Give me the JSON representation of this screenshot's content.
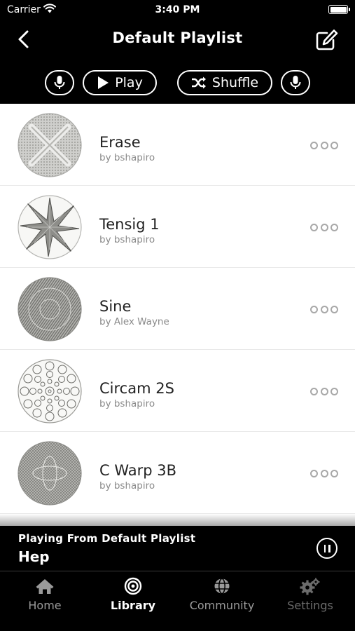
{
  "status_bar": {
    "carrier": "Carrier",
    "time": "3:40 PM"
  },
  "header": {
    "title": "Default Playlist",
    "back_icon": "chevron-left-icon",
    "edit_icon": "edit-square-icon"
  },
  "controls": {
    "play_label": "Play",
    "shuffle_label": "Shuffle"
  },
  "tracks": [
    {
      "title": "Erase",
      "author": "by bshapiro",
      "pattern": "x-cross"
    },
    {
      "title": "Tensig 1",
      "author": "by bshapiro",
      "pattern": "star"
    },
    {
      "title": "Sine",
      "author": "by Alex Wayne",
      "pattern": "dense-texture"
    },
    {
      "title": "Circam 2S",
      "author": "by bshapiro",
      "pattern": "circles"
    },
    {
      "title": "C Warp 3B",
      "author": "by bshapiro",
      "pattern": "warp-grid"
    }
  ],
  "now_playing": {
    "label": "Playing From Default Playlist",
    "title": "Hep",
    "state": "playing"
  },
  "tabs": [
    {
      "label": "Home",
      "icon": "home-icon",
      "active": false
    },
    {
      "label": "Library",
      "icon": "target-icon",
      "active": true
    },
    {
      "label": "Community",
      "icon": "globe-icon",
      "active": false
    },
    {
      "label": "Settings",
      "icon": "gears-icon",
      "active": false,
      "disabled": true
    }
  ],
  "colors": {
    "background": "#000000",
    "list_background": "#ffffff",
    "title_text": "#222222",
    "subtitle_text": "#8a8a8a"
  }
}
